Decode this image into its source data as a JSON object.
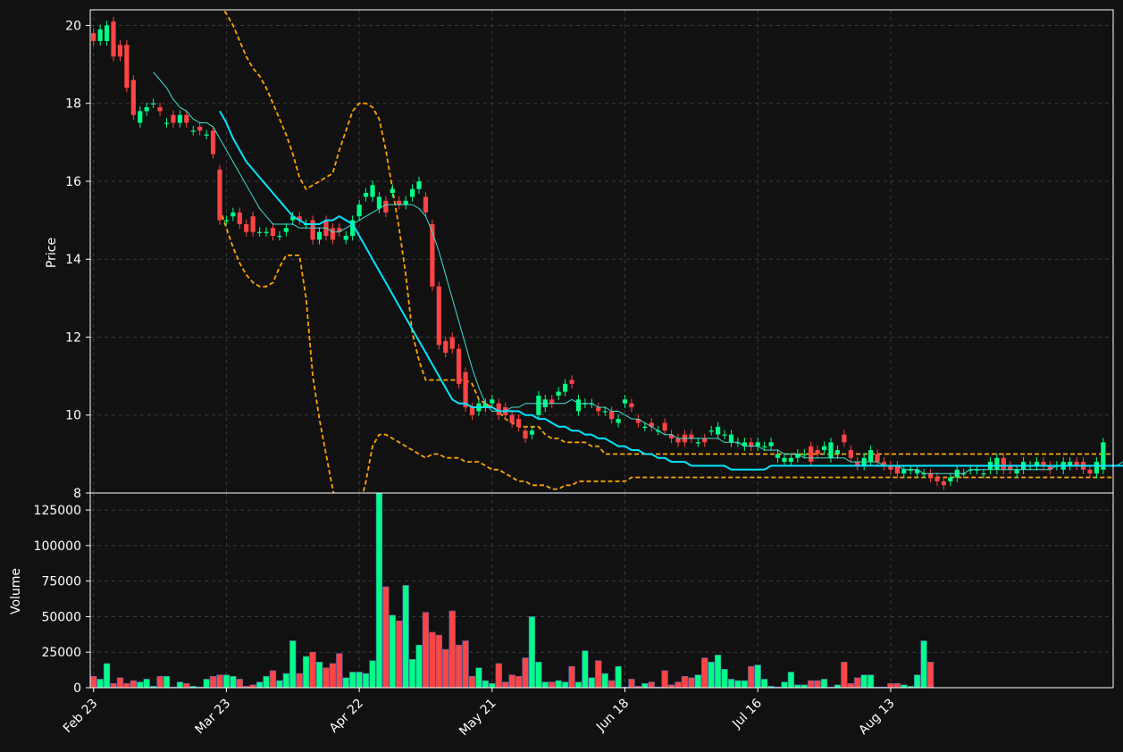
{
  "chart_data": {
    "type": "candlestick",
    "title": "",
    "price_panel": {
      "ylabel": "Price",
      "ylim": [
        8,
        20.4
      ],
      "yticks": [
        8,
        10,
        12,
        14,
        16,
        18,
        20
      ],
      "grid": true
    },
    "volume_panel": {
      "ylabel": "Volume",
      "ylim": [
        0,
        137000
      ],
      "yticks": [
        0,
        25000,
        50000,
        75000,
        100000,
        125000
      ],
      "grid": true
    },
    "xtick_labels": [
      "Feb 23",
      "Mar 23",
      "Apr 22",
      "May 21",
      "Jun 18",
      "Jul 16",
      "Aug 13"
    ],
    "colors": {
      "background": "#111111",
      "up": "#00ff88",
      "down": "#ff4444",
      "ma_short": "#40e0d0",
      "ma_long": "#00e5ff",
      "bands": "#ffa500",
      "grid": "#3a3a3a",
      "text": "#ffffff"
    },
    "series": [
      {
        "name": "MA short",
        "style": "thin-line"
      },
      {
        "name": "MA long",
        "style": "thick-line"
      },
      {
        "name": "Upper band",
        "style": "dashed"
      },
      {
        "name": "Lower band",
        "style": "dashed"
      }
    ],
    "ohlcv": {
      "open": [
        19.8,
        19.6,
        19.6,
        20.1,
        19.5,
        19.5,
        18.6,
        17.5,
        17.8,
        18.0,
        17.9,
        17.5,
        17.7,
        17.5,
        17.7,
        17.3,
        17.4,
        17.2,
        17.3,
        16.3,
        15.0,
        15.1,
        15.2,
        14.9,
        15.1,
        14.7,
        14.7,
        14.8,
        14.6,
        14.7,
        15.0,
        15.1,
        14.9,
        15.0,
        14.5,
        15.0,
        14.8,
        14.8,
        14.5,
        14.6,
        15.1,
        15.6,
        15.6,
        15.3,
        15.5,
        15.7,
        15.5,
        15.4,
        15.6,
        15.8,
        15.6,
        14.9,
        13.3,
        11.9,
        12.0,
        11.7,
        11.1,
        10.2,
        10.1,
        10.2,
        10.3,
        10.3,
        10.2,
        10.0,
        9.9,
        9.6,
        9.5,
        10.0,
        10.2,
        10.4,
        10.5,
        10.6,
        10.9,
        10.1,
        10.3,
        10.3,
        10.2,
        10.1,
        10.1,
        9.8,
        10.3,
        10.3,
        9.9,
        9.7,
        9.8,
        9.6,
        9.8,
        9.5,
        9.4,
        9.5,
        9.5,
        9.3,
        9.4,
        9.6,
        9.5,
        9.5,
        9.3,
        9.3,
        9.2,
        9.3,
        9.2,
        9.2,
        9.2,
        8.9,
        8.8,
        8.8,
        8.9,
        9.0,
        9.2,
        9.1,
        9.1,
        8.9,
        9.0,
        9.5,
        9.1,
        8.8,
        8.7,
        8.8,
        9.0,
        8.8,
        8.7,
        8.7,
        8.5,
        8.6,
        8.5,
        8.5,
        8.5,
        8.4,
        8.3,
        8.3,
        8.4,
        8.5,
        8.6,
        8.6,
        8.5,
        8.6,
        8.6,
        8.9,
        8.7,
        8.5,
        8.6,
        8.7,
        8.7,
        8.8,
        8.7,
        8.7,
        8.6,
        8.7,
        8.8,
        8.8,
        8.6,
        8.5,
        8.6,
        8.8
      ],
      "close": [
        19.6,
        19.9,
        20.0,
        19.2,
        19.2,
        18.4,
        17.7,
        17.8,
        17.9,
        18.0,
        17.8,
        17.5,
        17.5,
        17.7,
        17.5,
        17.3,
        17.3,
        17.2,
        16.7,
        15.0,
        15.0,
        15.2,
        14.9,
        14.7,
        14.7,
        14.7,
        14.7,
        14.6,
        14.6,
        14.8,
        15.1,
        15.0,
        14.9,
        14.5,
        14.7,
        14.6,
        14.5,
        14.7,
        14.6,
        15.0,
        15.4,
        15.7,
        15.9,
        15.6,
        15.2,
        15.8,
        15.4,
        15.5,
        15.8,
        16.0,
        15.2,
        13.3,
        11.8,
        11.6,
        11.7,
        10.8,
        10.2,
        10.0,
        10.3,
        10.3,
        10.4,
        10.0,
        10.0,
        9.8,
        9.7,
        9.4,
        9.6,
        10.5,
        10.4,
        10.3,
        10.6,
        10.8,
        10.8,
        10.4,
        10.3,
        10.3,
        10.1,
        10.1,
        9.9,
        9.9,
        10.4,
        10.2,
        9.8,
        9.7,
        9.7,
        9.6,
        9.6,
        9.4,
        9.3,
        9.3,
        9.4,
        9.3,
        9.3,
        9.6,
        9.7,
        9.5,
        9.5,
        9.3,
        9.3,
        9.2,
        9.3,
        9.2,
        9.3,
        9.0,
        8.9,
        8.9,
        9.0,
        9.0,
        8.8,
        9.0,
        9.2,
        9.3,
        9.1,
        9.3,
        8.9,
        8.7,
        8.9,
        9.1,
        8.8,
        8.7,
        8.6,
        8.5,
        8.6,
        8.6,
        8.6,
        8.5,
        8.4,
        8.3,
        8.2,
        8.4,
        8.6,
        8.5,
        8.6,
        8.6,
        8.5,
        8.8,
        8.9,
        8.6,
        8.6,
        8.6,
        8.8,
        8.7,
        8.8,
        8.7,
        8.6,
        8.7,
        8.8,
        8.8,
        8.7,
        8.6,
        8.5,
        8.8,
        9.3
      ],
      "volume": [
        8000,
        6000,
        17000,
        3000,
        7000,
        3000,
        5000,
        4000,
        6000,
        1000,
        8000,
        8000,
        500,
        4000,
        3000,
        1000,
        500,
        6000,
        8000,
        9000,
        9000,
        8000,
        6000,
        1000,
        2000,
        4000,
        8000,
        12000,
        5000,
        10000,
        33000,
        10000,
        22000,
        25000,
        18000,
        14000,
        17000,
        24000,
        7000,
        11000,
        11000,
        10000,
        19000,
        137000,
        71000,
        51000,
        47000,
        72000,
        20000,
        30000,
        53000,
        39000,
        37000,
        27000,
        54000,
        30000,
        33000,
        8000,
        14000,
        5000,
        3000,
        17000,
        4000,
        9000,
        8000,
        21000,
        50000,
        18000,
        4000,
        4000,
        5000,
        4000,
        15000,
        4000,
        26000,
        7000,
        19000,
        10000,
        5000,
        15000,
        500,
        6000,
        1000,
        3000,
        4000,
        500,
        12000,
        2000,
        4000,
        8000,
        7000,
        9000,
        21000,
        18000,
        23000,
        13000,
        6000,
        5000,
        5000,
        15000,
        16000,
        6000,
        1000,
        500,
        4000,
        11000,
        2000,
        2000,
        5000,
        5000,
        6000,
        500,
        2000,
        18000,
        3000,
        7000,
        9000,
        9000,
        500,
        500,
        3000,
        3000,
        2000,
        1000,
        9000,
        33000,
        18000
      ]
    },
    "ma_short_values": [
      null,
      null,
      null,
      null,
      null,
      null,
      null,
      null,
      null,
      18.8,
      18.6,
      18.4,
      18.1,
      17.9,
      17.8,
      17.6,
      17.5,
      17.5,
      17.4,
      17.1,
      16.8,
      16.5,
      16.2,
      15.9,
      15.6,
      15.3,
      15.1,
      14.9,
      14.9,
      14.9,
      14.9,
      14.8,
      14.8,
      14.8,
      14.8,
      14.8,
      14.7,
      14.7,
      14.8,
      14.9,
      15.0,
      15.1,
      15.2,
      15.3,
      15.4,
      15.4,
      15.4,
      15.4,
      15.4,
      15.3,
      15.1,
      14.7,
      14.2,
      13.6,
      13.0,
      12.4,
      11.8,
      11.2,
      10.7,
      10.3,
      10.1,
      10.1,
      10.1,
      10.2,
      10.2,
      10.3,
      10.3,
      10.3,
      10.3,
      10.3,
      10.3,
      10.3,
      10.4,
      10.3,
      10.3,
      10.3,
      10.2,
      10.2,
      10.1,
      10.1,
      10.0,
      9.9,
      9.9,
      9.8,
      9.7,
      9.6,
      9.5,
      9.5,
      9.4,
      9.4,
      9.4,
      9.4,
      9.4,
      9.4,
      9.4,
      9.3,
      9.3,
      9.3,
      9.2,
      9.2,
      9.2,
      9.1,
      9.1,
      9.1,
      9.0,
      9.0,
      9.0,
      8.9,
      8.9,
      8.9,
      8.9,
      8.9,
      8.9,
      8.9,
      8.8,
      8.8,
      8.8,
      8.8,
      8.8,
      8.7,
      8.7,
      8.7,
      8.6,
      8.6,
      8.6,
      8.5,
      8.5,
      8.5,
      8.5,
      8.5,
      8.5,
      8.5,
      8.6,
      8.6,
      8.6,
      8.6,
      8.6,
      8.6,
      8.6,
      8.6,
      8.6,
      8.6,
      8.6,
      8.6,
      8.6,
      8.7,
      8.7,
      8.7,
      8.7,
      8.7,
      8.7,
      8.7,
      8.7,
      8.7,
      8.7,
      8.8,
      8.8,
      8.8
    ],
    "ma_long_values": [
      null,
      null,
      null,
      null,
      null,
      null,
      null,
      null,
      null,
      null,
      null,
      null,
      null,
      null,
      null,
      null,
      null,
      null,
      null,
      17.8,
      17.5,
      17.1,
      16.8,
      16.5,
      16.3,
      16.1,
      15.9,
      15.7,
      15.5,
      15.3,
      15.1,
      15.0,
      14.9,
      14.9,
      14.9,
      15.0,
      15.0,
      15.1,
      15.0,
      14.9,
      14.6,
      14.3,
      14.0,
      13.7,
      13.4,
      13.1,
      12.8,
      12.5,
      12.2,
      11.9,
      11.6,
      11.3,
      11.0,
      10.7,
      10.4,
      10.3,
      10.3,
      10.2,
      10.2,
      10.2,
      10.2,
      10.1,
      10.1,
      10.1,
      10.1,
      10.0,
      10.0,
      9.9,
      9.9,
      9.8,
      9.7,
      9.7,
      9.6,
      9.6,
      9.5,
      9.5,
      9.4,
      9.4,
      9.3,
      9.2,
      9.2,
      9.1,
      9.1,
      9.0,
      9.0,
      8.9,
      8.9,
      8.8,
      8.8,
      8.8,
      8.7,
      8.7,
      8.7,
      8.7,
      8.7,
      8.7,
      8.6,
      8.6,
      8.6,
      8.6,
      8.6,
      8.6,
      8.7,
      8.7,
      8.7,
      8.7,
      8.7,
      8.7,
      8.7,
      8.7,
      8.7,
      8.7,
      8.7,
      8.7,
      8.7,
      8.7,
      8.7,
      8.7,
      8.7,
      8.7,
      8.7,
      8.7,
      8.7,
      8.7,
      8.7,
      8.7,
      8.7,
      8.7,
      8.7,
      8.7,
      8.7,
      8.7,
      8.7,
      8.7,
      8.7,
      8.7,
      8.7,
      8.7,
      8.7,
      8.7,
      8.7,
      8.7,
      8.7,
      8.7,
      8.7,
      8.7,
      8.7,
      8.7,
      8.7,
      8.7,
      8.7,
      8.7,
      8.7,
      8.7,
      8.7,
      8.7,
      8.7,
      8.8
    ],
    "upper_band": [
      null,
      null,
      null,
      null,
      null,
      null,
      null,
      null,
      null,
      null,
      null,
      null,
      null,
      null,
      null,
      null,
      null,
      null,
      null,
      20.5,
      20.3,
      20.0,
      19.6,
      19.2,
      18.9,
      18.7,
      18.4,
      18.0,
      17.6,
      17.2,
      16.7,
      16.1,
      15.8,
      15.9,
      16.0,
      16.1,
      16.2,
      16.8,
      17.3,
      17.8,
      18.0,
      18.0,
      17.9,
      17.6,
      16.8,
      15.8,
      14.8,
      13.6,
      12.1,
      11.4,
      10.9,
      10.9,
      10.9,
      10.9,
      10.9,
      10.9,
      10.9,
      10.8,
      10.4,
      10.3,
      10.2,
      10.1,
      9.9,
      9.8,
      9.7,
      9.7,
      9.7,
      9.7,
      9.5,
      9.4,
      9.4,
      9.3,
      9.3,
      9.3,
      9.3,
      9.2,
      9.2,
      9.0,
      9.0,
      9.0,
      9.0,
      9.0,
      9.0,
      9.0,
      9.0,
      9.0,
      9.0,
      9.0,
      9.0,
      9.0,
      9.0,
      9.0,
      9.0,
      9.0,
      9.0,
      9.0,
      9.0,
      9.0,
      9.0,
      9.0,
      9.0,
      9.0,
      9.0,
      9.0,
      9.0,
      9.0,
      9.0,
      9.0,
      9.0,
      9.0,
      9.0,
      9.0,
      9.0,
      9.0,
      9.0,
      9.0,
      9.0,
      9.0,
      9.0,
      9.0,
      9.0,
      9.0,
      9.0,
      9.0,
      9.0,
      9.0,
      9.0,
      9.0,
      9.0,
      9.0,
      9.0,
      9.0,
      9.0,
      9.0,
      9.0,
      9.0,
      9.0,
      9.0,
      9.0,
      9.0,
      9.0,
      9.0,
      9.0,
      9.0,
      9.0,
      9.0,
      9.0,
      9.0,
      9.0,
      9.0,
      9.0,
      9.0,
      9.0,
      9.0,
      9.0,
      9.0,
      9.0,
      9.0,
      9.0,
      9.1
    ],
    "lower_band": [
      null,
      null,
      null,
      null,
      null,
      null,
      null,
      null,
      null,
      null,
      null,
      null,
      null,
      null,
      null,
      null,
      null,
      null,
      null,
      15.3,
      14.8,
      14.3,
      13.9,
      13.6,
      13.4,
      13.3,
      13.3,
      13.4,
      13.8,
      14.1,
      14.1,
      14.1,
      13.0,
      11.0,
      9.9,
      9.0,
      8.1,
      7.4,
      7.3,
      7.3,
      7.6,
      8.3,
      9.2,
      9.5,
      9.5,
      9.4,
      9.3,
      9.2,
      9.1,
      9.0,
      8.9,
      9.0,
      9.0,
      8.9,
      8.9,
      8.9,
      8.8,
      8.8,
      8.8,
      8.7,
      8.6,
      8.6,
      8.5,
      8.4,
      8.3,
      8.3,
      8.2,
      8.2,
      8.2,
      8.1,
      8.1,
      8.2,
      8.2,
      8.3,
      8.3,
      8.3,
      8.3,
      8.3,
      8.3,
      8.3,
      8.3,
      8.4,
      8.4,
      8.4,
      8.4,
      8.4,
      8.4,
      8.4,
      8.4,
      8.4,
      8.4,
      8.4,
      8.4,
      8.4,
      8.4,
      8.4,
      8.4,
      8.4,
      8.4,
      8.4,
      8.4,
      8.4,
      8.4,
      8.4,
      8.4,
      8.4,
      8.4,
      8.4,
      8.4,
      8.4,
      8.4,
      8.4,
      8.4,
      8.4,
      8.4,
      8.4,
      8.4,
      8.4,
      8.4,
      8.4,
      8.4,
      8.4,
      8.4,
      8.4,
      8.4,
      8.4,
      8.4,
      8.4,
      8.4,
      8.4,
      8.4,
      8.4,
      8.4,
      8.4,
      8.4,
      8.4,
      8.4,
      8.4,
      8.4,
      8.4,
      8.4,
      8.4,
      8.4,
      8.4,
      8.4,
      8.4,
      8.4,
      8.4,
      8.4,
      8.4,
      8.4,
      8.4,
      8.4,
      8.4,
      8.4,
      8.4,
      8.4,
      8.4,
      8.4,
      8.4,
      8.4,
      8.4,
      8.4,
      8.4,
      8.4,
      8.4
    ]
  }
}
